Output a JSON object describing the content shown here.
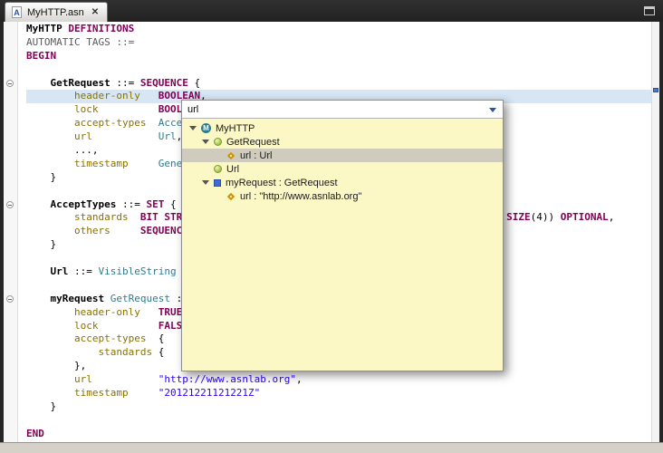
{
  "colors": {
    "keyword": "#7F0055",
    "type": "#2E7B8E",
    "field": "#8A7100",
    "string": "#2A00FF",
    "gray": "#5A5A5A",
    "line_highlight": "#D6E6F5",
    "popup_bg": "#FBF8C6",
    "selection_bg": "#CFCBBD"
  },
  "tab": {
    "title": "MyHTTP.asn",
    "icon_letter": "A",
    "close_glyph": "✕"
  },
  "editor": {
    "lines": [
      {
        "seg": [
          {
            "t": "MyHTTP ",
            "c": "def"
          },
          {
            "t": "DEFINITIONS",
            "c": "kw"
          }
        ]
      },
      {
        "seg": [
          {
            "t": "AUTOMATIC TAGS ::=",
            "c": "gray"
          }
        ]
      },
      {
        "seg": [
          {
            "t": "BEGIN",
            "c": "kw"
          }
        ]
      },
      {
        "seg": []
      },
      {
        "fold": true,
        "seg": [
          {
            "t": "    ",
            "c": "plain"
          },
          {
            "t": "GetRequest",
            "c": "def"
          },
          {
            "t": " ::= ",
            "c": "plain"
          },
          {
            "t": "SEQUENCE",
            "c": "kw"
          },
          {
            "t": " {",
            "c": "plain"
          }
        ]
      },
      {
        "hl": true,
        "seg": [
          {
            "t": "        ",
            "c": "plain"
          },
          {
            "t": "header-only",
            "c": "field"
          },
          {
            "t": "   ",
            "c": "plain"
          },
          {
            "t": "BOOLEAN",
            "c": "kw"
          },
          {
            "t": ",",
            "c": "plain"
          }
        ]
      },
      {
        "seg": [
          {
            "t": "        ",
            "c": "plain"
          },
          {
            "t": "lock",
            "c": "field"
          },
          {
            "t": "          ",
            "c": "plain"
          },
          {
            "t": "BOOLEAN",
            "c": "kw"
          },
          {
            "t": ",",
            "c": "plain"
          }
        ]
      },
      {
        "seg": [
          {
            "t": "        ",
            "c": "plain"
          },
          {
            "t": "accept-types",
            "c": "field"
          },
          {
            "t": "  ",
            "c": "plain"
          },
          {
            "t": "AcceptTypes",
            "c": "type"
          },
          {
            "t": ",",
            "c": "plain"
          }
        ]
      },
      {
        "seg": [
          {
            "t": "        ",
            "c": "plain"
          },
          {
            "t": "url",
            "c": "field"
          },
          {
            "t": "           ",
            "c": "plain"
          },
          {
            "t": "Url",
            "c": "type"
          },
          {
            "t": ",",
            "c": "plain"
          }
        ]
      },
      {
        "seg": [
          {
            "t": "        ...,",
            "c": "plain"
          }
        ]
      },
      {
        "seg": [
          {
            "t": "        ",
            "c": "plain"
          },
          {
            "t": "timestamp",
            "c": "field"
          },
          {
            "t": "     ",
            "c": "plain"
          },
          {
            "t": "GeneralizedTime",
            "c": "type"
          }
        ]
      },
      {
        "seg": [
          {
            "t": "    }",
            "c": "plain"
          }
        ]
      },
      {
        "seg": []
      },
      {
        "fold": true,
        "seg": [
          {
            "t": "    ",
            "c": "plain"
          },
          {
            "t": "AcceptTypes",
            "c": "def"
          },
          {
            "t": " ::= ",
            "c": "plain"
          },
          {
            "t": "SET",
            "c": "kw"
          },
          {
            "t": " {",
            "c": "plain"
          }
        ]
      },
      {
        "seg": [
          {
            "t": "        ",
            "c": "plain"
          },
          {
            "t": "standards",
            "c": "field"
          },
          {
            "t": "  ",
            "c": "plain"
          },
          {
            "t": "BIT STRING",
            "c": "kw"
          },
          {
            "sp": 338
          },
          {
            "t": "SIZE",
            "c": "kw"
          },
          {
            "t": "(4)) ",
            "c": "plain"
          },
          {
            "t": "OPTIONAL",
            "c": "kw"
          },
          {
            "t": ",",
            "c": "plain"
          }
        ]
      },
      {
        "seg": [
          {
            "t": "        ",
            "c": "plain"
          },
          {
            "t": "others",
            "c": "field"
          },
          {
            "t": "     ",
            "c": "plain"
          },
          {
            "t": "SEQUENCE",
            "c": "kw"
          }
        ]
      },
      {
        "seg": [
          {
            "t": "    }",
            "c": "plain"
          }
        ]
      },
      {
        "seg": []
      },
      {
        "seg": [
          {
            "t": "    ",
            "c": "plain"
          },
          {
            "t": "Url",
            "c": "def"
          },
          {
            "t": " ::= ",
            "c": "plain"
          },
          {
            "t": "VisibleString",
            "c": "type"
          }
        ]
      },
      {
        "seg": []
      },
      {
        "fold": true,
        "seg": [
          {
            "t": "    ",
            "c": "plain"
          },
          {
            "t": "myRequest",
            "c": "def"
          },
          {
            "t": " ",
            "c": "plain"
          },
          {
            "t": "GetRequest",
            "c": "type"
          },
          {
            "t": " ::= {",
            "c": "plain"
          }
        ]
      },
      {
        "seg": [
          {
            "t": "        ",
            "c": "plain"
          },
          {
            "t": "header-only",
            "c": "field"
          },
          {
            "t": "   ",
            "c": "plain"
          },
          {
            "t": "TRUE",
            "c": "kw"
          },
          {
            "t": ",",
            "c": "plain"
          }
        ]
      },
      {
        "seg": [
          {
            "t": "        ",
            "c": "plain"
          },
          {
            "t": "lock",
            "c": "field"
          },
          {
            "t": "          ",
            "c": "plain"
          },
          {
            "t": "FALSE",
            "c": "kw"
          },
          {
            "t": ",",
            "c": "plain"
          }
        ]
      },
      {
        "seg": [
          {
            "t": "        ",
            "c": "plain"
          },
          {
            "t": "accept-types",
            "c": "field"
          },
          {
            "t": "  {",
            "c": "plain"
          }
        ]
      },
      {
        "seg": [
          {
            "t": "            ",
            "c": "plain"
          },
          {
            "t": "standards",
            "c": "field"
          },
          {
            "t": " {",
            "c": "plain"
          }
        ]
      },
      {
        "seg": [
          {
            "t": "        },",
            "c": "plain"
          }
        ]
      },
      {
        "seg": [
          {
            "t": "        ",
            "c": "plain"
          },
          {
            "t": "url",
            "c": "field"
          },
          {
            "t": "           ",
            "c": "plain"
          },
          {
            "t": "\"http://www.asnlab.org\"",
            "c": "str"
          },
          {
            "t": ",",
            "c": "plain"
          }
        ]
      },
      {
        "seg": [
          {
            "t": "        ",
            "c": "plain"
          },
          {
            "t": "timestamp",
            "c": "field"
          },
          {
            "t": "     ",
            "c": "plain"
          },
          {
            "t": "\"20121221121221Z\"",
            "c": "str"
          }
        ]
      },
      {
        "seg": [
          {
            "t": "    }",
            "c": "plain"
          }
        ]
      },
      {
        "seg": []
      },
      {
        "seg": [
          {
            "t": "END",
            "c": "kw"
          }
        ]
      }
    ]
  },
  "popup": {
    "filter": "url",
    "rows": [
      {
        "depth": 0,
        "expander": true,
        "icon": "module",
        "icon_text": "M",
        "label": "MyHTTP",
        "selected": false
      },
      {
        "depth": 1,
        "expander": true,
        "icon": "type",
        "label": "GetRequest",
        "selected": false
      },
      {
        "depth": 2,
        "expander": false,
        "icon": "field",
        "label": "url : Url",
        "selected": true
      },
      {
        "depth": 1,
        "expander": false,
        "icon": "type",
        "label": "Url",
        "selected": false
      },
      {
        "depth": 1,
        "expander": true,
        "icon": "value",
        "label": "myRequest : GetRequest",
        "selected": false
      },
      {
        "depth": 2,
        "expander": false,
        "icon": "field",
        "label": "url : \"http://www.asnlab.org\"",
        "selected": false
      }
    ]
  }
}
